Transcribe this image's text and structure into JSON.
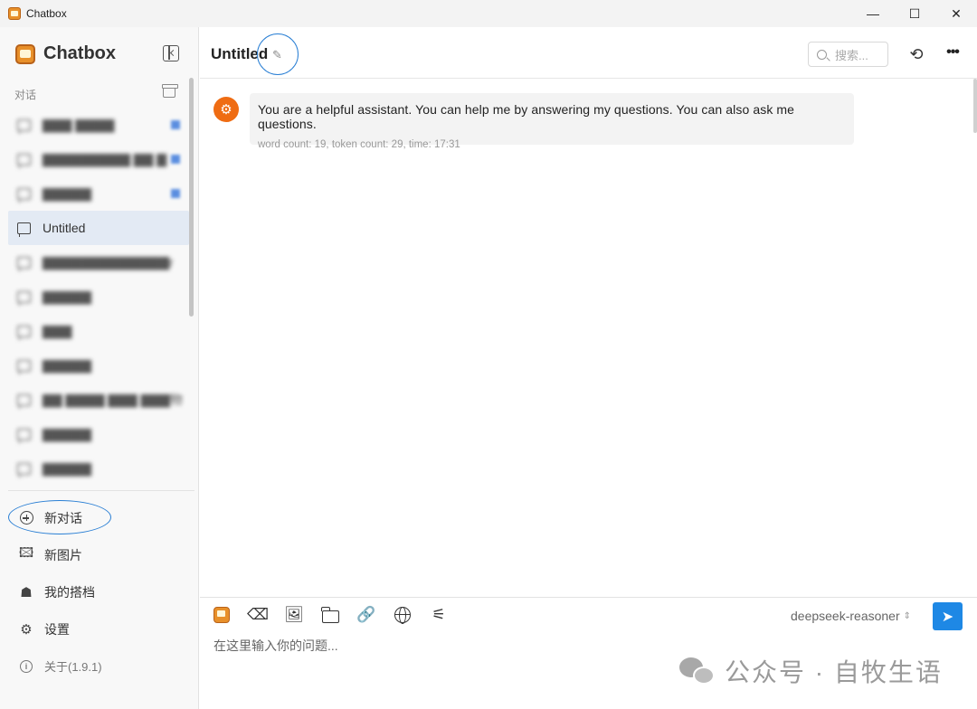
{
  "window": {
    "title": "Chatbox",
    "minimize": "—",
    "maximize": "☐",
    "close": "✕"
  },
  "sidebar": {
    "brand": "Chatbox",
    "section_label": "对话",
    "conversations": [
      {
        "label": "▇▇▇ ▇▇▇▇",
        "blurred": true,
        "badge": true
      },
      {
        "label": "▇▇▇▇▇▇▇▇▇ ▇▇ ▇",
        "blurred": true,
        "badge": true
      },
      {
        "label": "▇▇▇▇▇",
        "blurred": true,
        "badge": true
      },
      {
        "label": "Untitled",
        "blurred": false,
        "active": true
      },
      {
        "label": "▇▇▇▇▇▇▇▇▇▇▇▇▇r",
        "blurred": true
      },
      {
        "label": "▇▇▇▇▇",
        "blurred": true
      },
      {
        "label": "▇▇▇",
        "blurred": true
      },
      {
        "label": "▇▇▇▇▇",
        "blurred": true
      },
      {
        "label": "▇▇ ▇▇▇▇ ▇▇▇ ▇▇▇物",
        "blurred": true
      },
      {
        "label": "▇▇▇▇▇",
        "blurred": true
      },
      {
        "label": "▇▇▇▇▇",
        "blurred": true
      }
    ],
    "menu": {
      "new_chat": "新对话",
      "new_image": "新图片",
      "my_copilots": "我的搭档",
      "settings": "设置",
      "about": "关于(1.9.1)"
    }
  },
  "header": {
    "title": "Untitled",
    "search_placeholder": "搜索..."
  },
  "messages": [
    {
      "role": "system",
      "text": "You are a helpful assistant. You can help me by answering my questions. You can also ask me questions.",
      "meta": "word count: 19, token count: 29, time: 17:31"
    }
  ],
  "composer": {
    "model": "deepseek-reasoner",
    "placeholder": "在这里输入你的问题..."
  },
  "watermark": "公众号 · 自牧生语",
  "colors": {
    "accent": "#1e88e5",
    "avatar": "#ef6c13",
    "annotation": "#2a7fd4",
    "active_row": "#e3eaf4"
  }
}
